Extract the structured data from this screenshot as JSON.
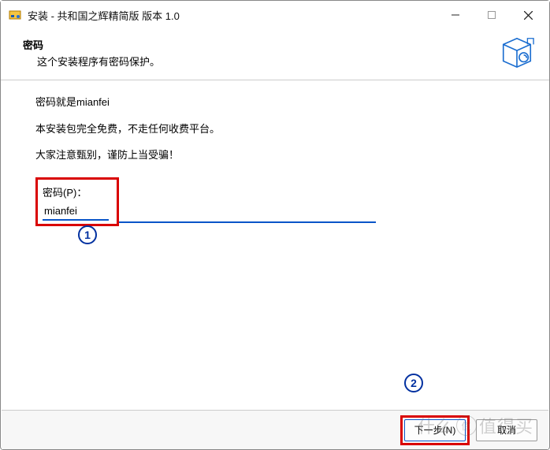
{
  "titlebar": {
    "title": "安装 - 共和国之辉精简版 版本 1.0"
  },
  "header": {
    "title": "密码",
    "subtitle": "这个安装程序有密码保护。"
  },
  "content": {
    "line1": "密码就是mianfei",
    "line2": "本安装包完全免费，不走任何收费平台。",
    "line3": "大家注意甄别，谨防上当受骗！",
    "pw_label": "密码(P)：",
    "pw_value": "mianfei"
  },
  "annotations": {
    "badge1": "1",
    "badge2": "2"
  },
  "footer": {
    "next_label": "下一步(N)",
    "cancel_label": "取消"
  },
  "watermark": {
    "left": "什么",
    "right": "值得买"
  }
}
